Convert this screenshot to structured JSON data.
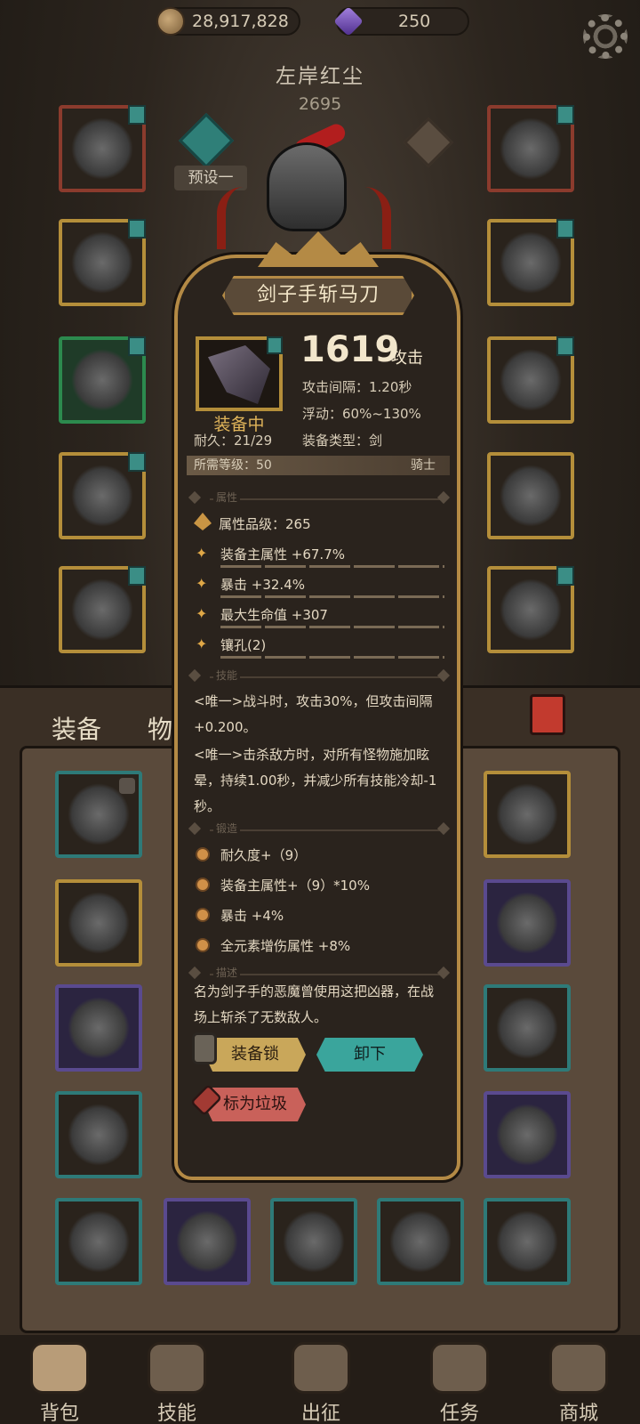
{
  "currency": {
    "gold": "28,917,828",
    "gems": "250"
  },
  "character": {
    "name": "左岸红尘",
    "power": "2695",
    "preset": "预设一"
  },
  "tabs": {
    "equipment": "装备",
    "items": "物品"
  },
  "nav": {
    "bag": "背包",
    "skills": "技能",
    "expedition": "出征",
    "tasks": "任务",
    "shop": "商城",
    "active": "bag"
  },
  "item": {
    "name": "剑子手斩马刀",
    "equipped_label": "装备中",
    "attack": "1619",
    "attack_label": "攻击",
    "interval": "攻击间隔：1.20秒",
    "float": "浮动：60%~130%",
    "durability": "耐久：21/29",
    "type": "装备类型：剑",
    "required_level": "所需等级：50",
    "class": "骑士",
    "sections": {
      "attributes": "属性",
      "skills": "技能",
      "forge": "锻造",
      "description": "描述"
    },
    "attr_quality": "属性品级：265",
    "attributes": [
      "装备主属性 +67.7%",
      "暴击 +32.4%",
      "最大生命值 +307",
      "镶孔(2)"
    ],
    "skills": [
      "<唯一>战斗时，攻击30%，但攻击间隔+0.200。",
      "<唯一>击杀敌方时，对所有怪物施加眩晕，持续1.00秒，并减少所有技能冷却-1秒。"
    ],
    "forge": [
      "耐久度+（9）",
      "装备主属性+（9）*10%",
      "暴击 +4%",
      "全元素增伤属性 +8%"
    ],
    "description": "名为剑子手的恶魔曾使用这把凶器，在战场上斩杀了无数敌人。",
    "buttons": {
      "lock": "装备锁",
      "unequip": "卸下",
      "junk": "标为垃圾"
    }
  },
  "colors": {
    "gold_frame": "#b48a45",
    "teal_button": "#3aa59c",
    "lock_button": "#c9a75a",
    "junk_button": "#c9615a"
  }
}
